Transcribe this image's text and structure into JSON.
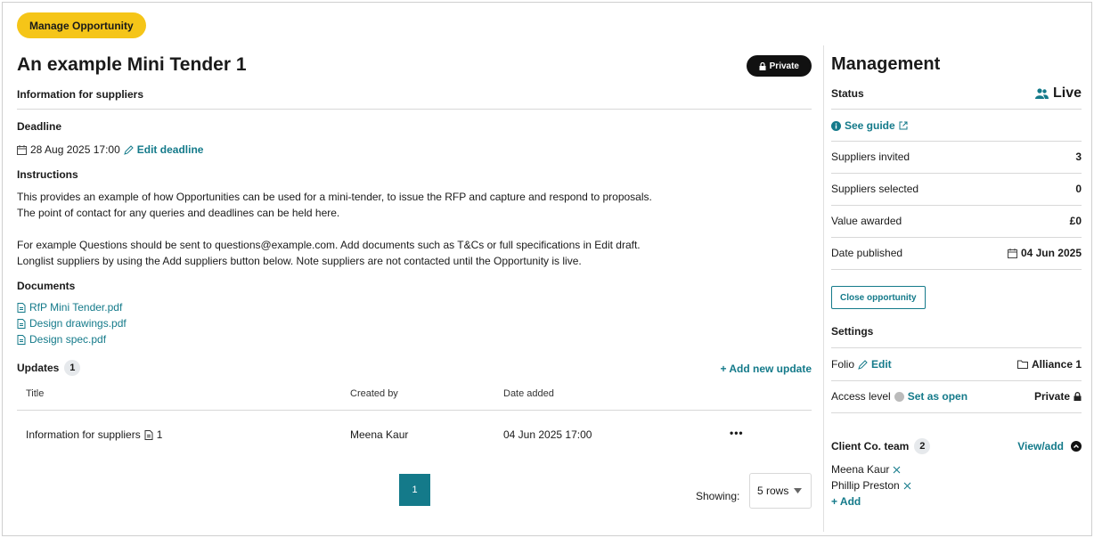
{
  "header": {
    "manage_label": "Manage Opportunity"
  },
  "main": {
    "title": "An example Mini Tender 1",
    "private_label": "Private",
    "subhead": "Information for suppliers",
    "deadline_label": "Deadline",
    "deadline_value": "28 Aug 2025 17:00",
    "edit_deadline": "Edit deadline",
    "instructions_label": "Instructions",
    "instructions": [
      "This provides an example of how Opportunities can be used for a mini-tender, to issue the RFP and capture and respond to proposals.",
      "The point of contact for any queries and deadlines can be held here.",
      "For example Questions should be sent to questions@example.com. Add documents such as T&Cs or full specifications in Edit draft.",
      "Longlist suppliers by using the Add suppliers button below. Note suppliers are not contacted until the Opportunity is live."
    ],
    "documents_label": "Documents",
    "documents": [
      "RfP Mini Tender.pdf",
      "Design drawings.pdf",
      "Design spec.pdf"
    ],
    "updates_label": "Updates",
    "updates_count": "1",
    "add_update": "+ Add new update",
    "columns": [
      "Title",
      "Created by",
      "Date added"
    ],
    "rows": [
      {
        "title": "Information for suppliers",
        "attachments": "1",
        "created_by": "Meena Kaur",
        "date": "04 Jun 2025 17:00",
        "menu": "•••"
      }
    ],
    "page": "1",
    "showing_label": "Showing:",
    "rows_option": "5 rows"
  },
  "management": {
    "title": "Management",
    "status_label": "Status",
    "status_value": "Live",
    "see_guide": "See guide",
    "suppliers_invited_label": "Suppliers invited",
    "suppliers_invited": "3",
    "suppliers_selected_label": "Suppliers selected",
    "suppliers_selected": "0",
    "value_awarded_label": "Value awarded",
    "value_awarded": "£0",
    "date_published_label": "Date published",
    "date_published": "04 Jun 2025",
    "close_label": "Close opportunity",
    "settings_label": "Settings",
    "folio_label": "Folio",
    "folio_edit": "Edit",
    "folio_value": "Alliance 1",
    "access_label": "Access level",
    "set_open": "Set as open",
    "access_value": "Private",
    "team_label": "Client Co. team",
    "team_count": "2",
    "view_add": "View/add",
    "members": [
      "Meena Kaur",
      "Phillip Preston"
    ],
    "add_member": "+ Add"
  },
  "colors": {
    "accent": "#147a8a",
    "manage_pill": "#f5c518"
  }
}
